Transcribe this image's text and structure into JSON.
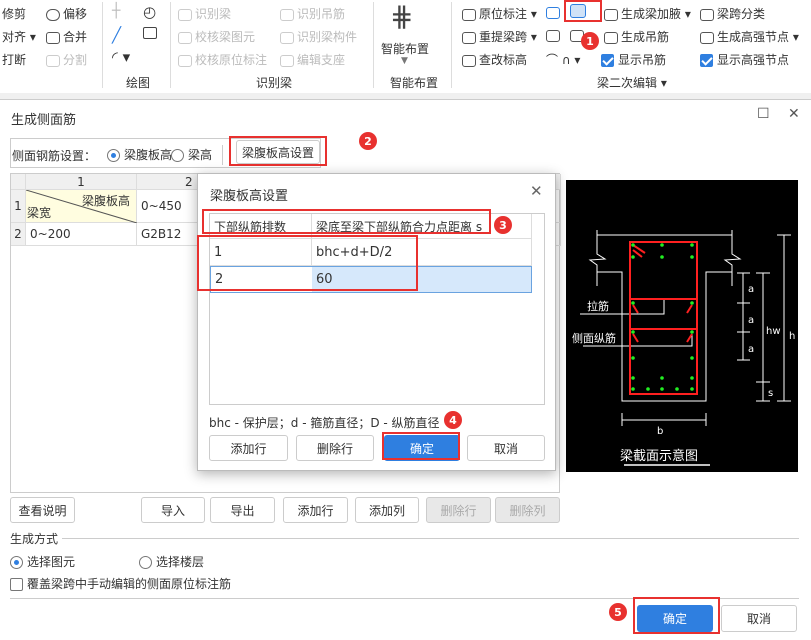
{
  "ribbon": {
    "edit": {
      "trim": "修剪",
      "offset": "偏移",
      "align": "对齐",
      "merge": "合并",
      "break": "打断",
      "split": "分割"
    },
    "draw": {
      "group": "绘图"
    },
    "identify": {
      "group": "识别梁",
      "identify_beam": "识别梁",
      "check_element": "校核梁图元",
      "check_annotation": "校核原位标注",
      "identify_hanger": "识别吊筋",
      "identify_component": "识别梁构件",
      "edit_support": "编辑支座"
    },
    "smart": {
      "label": "智能布置",
      "group": "智能布置"
    },
    "secondary": {
      "group": "梁二次编辑",
      "in_situ": "原位标注",
      "re_span": "重提梁跨",
      "check_elev": "查改标高",
      "gen_haunch": "生成梁加腋",
      "gen_hanger": "生成吊筋",
      "show_hanger": "显示吊筋",
      "span_class": "梁跨分类",
      "gen_hs_node": "生成高强节点",
      "show_hs_node": "显示高强节点"
    }
  },
  "dialog": {
    "title": "生成侧面筋",
    "setting_label": "侧面钢筋设置：",
    "radio_web": "梁腹板高",
    "radio_height": "梁高",
    "web_setting_button": "梁腹板高设置",
    "grid": {
      "col_headers": [
        "1",
        "2"
      ],
      "row_headers": [
        "1",
        "2"
      ],
      "corner_top": "梁腹板高",
      "corner_bottom": "梁宽",
      "r1c2": "0~450",
      "r2c1": "0~200",
      "r2c2": "G2B12"
    },
    "buttons": {
      "view_help": "查看说明",
      "import": "导入",
      "export": "导出",
      "add_row": "添加行",
      "add_col": "添加列",
      "del_row": "删除行",
      "del_col": "删除列"
    },
    "gen_mode_label": "生成方式",
    "radio_select_element": "选择图元",
    "radio_select_floor": "选择楼层",
    "override_checkbox": "覆盖梁跨中手动编辑的侧面原位标注筋",
    "ok": "确定",
    "cancel": "取消"
  },
  "diagram": {
    "tie_label": "拉筋",
    "side_label": "侧面纵筋",
    "a": "a",
    "hw": "hw",
    "h": "h",
    "s": "s",
    "b": "b",
    "caption": "梁截面示意图"
  },
  "subdialog": {
    "title": "梁腹板高设置",
    "columns": [
      "下部纵筋排数",
      "梁底至梁下部纵筋合力点距离 s"
    ],
    "rows": [
      [
        "1",
        "bhc+d+D/2"
      ],
      [
        "2",
        "60"
      ]
    ],
    "note": "bhc - 保护层；d - 箍筋直径；D - 纵筋直径",
    "add_row": "添加行",
    "del_row": "删除行",
    "ok": "确定",
    "cancel": "取消"
  },
  "badges": [
    "1",
    "2",
    "3",
    "4",
    "5"
  ],
  "colors": {
    "accent": "#2f7fe0",
    "annotation": "#e8312f",
    "rebar": "#ff2020",
    "bar_dot": "#22ee22"
  }
}
